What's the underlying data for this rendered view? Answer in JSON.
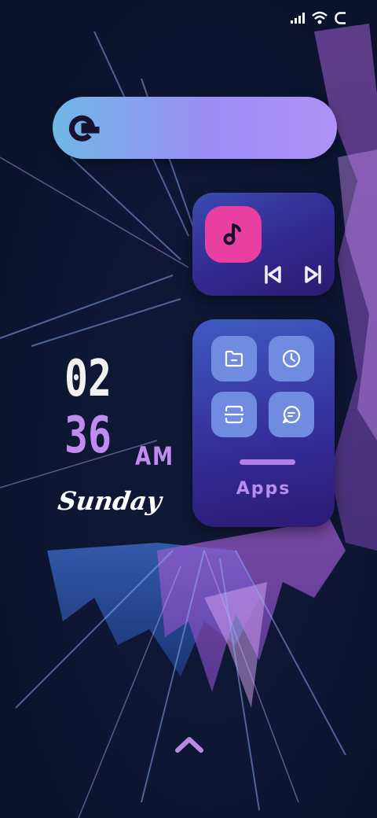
{
  "search": {
    "logo": "G"
  },
  "music": {
    "app_icon": "music-note-icon",
    "prev_icon": "skip-previous-icon",
    "next_icon": "skip-next-icon"
  },
  "apps_widget": {
    "label": "Apps",
    "tiles": [
      {
        "icon": "folder-icon"
      },
      {
        "icon": "clock-icon"
      },
      {
        "icon": "scan-icon"
      },
      {
        "icon": "chat-icon"
      }
    ]
  },
  "clock": {
    "hours": "02",
    "minutes": "36",
    "period": "AM",
    "day": "Sunday"
  },
  "colors": {
    "accent": "#c08cf0",
    "music_app": "#e93fa0",
    "tile": "#6f8ce0"
  }
}
